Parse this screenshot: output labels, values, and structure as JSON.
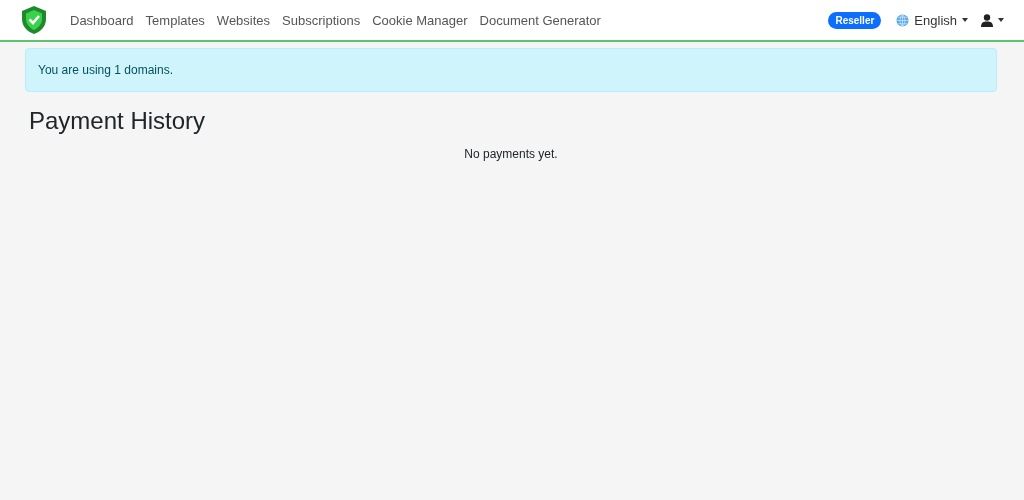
{
  "navbar": {
    "links": [
      {
        "label": "Dashboard"
      },
      {
        "label": "Templates"
      },
      {
        "label": "Websites"
      },
      {
        "label": "Subscriptions"
      },
      {
        "label": "Cookie Manager"
      },
      {
        "label": "Document Generator"
      }
    ],
    "badge": "Reseller",
    "language": "English"
  },
  "alert": "You are using 1 domains.",
  "heading": "Payment History",
  "empty_message": "No payments yet."
}
